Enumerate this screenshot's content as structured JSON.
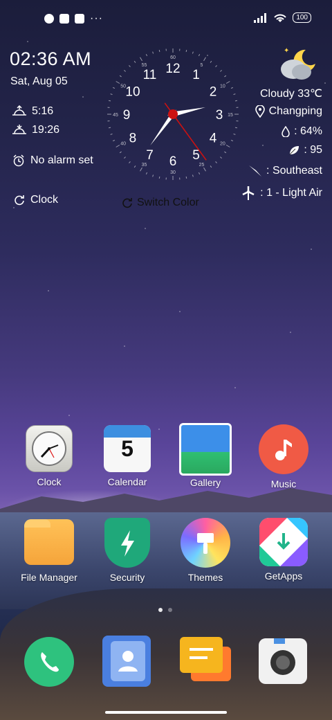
{
  "status_bar": {
    "battery": "100"
  },
  "clock_widget": {
    "time": "02:36 AM",
    "date": "Sat, Aug 05",
    "sunrise": "5:16",
    "sunset": "19:26",
    "alarm": "No alarm set",
    "clock_link": "Clock",
    "switch_color": "Switch Color",
    "dial_hours": [
      "12",
      "1",
      "2",
      "3",
      "4",
      "5",
      "6",
      "7",
      "8",
      "9",
      "10",
      "11"
    ],
    "dial_minutes": [
      "60",
      "5",
      "10",
      "15",
      "20",
      "25",
      "30",
      "35",
      "40",
      "45",
      "50",
      "55"
    ],
    "hands": {
      "hour": 2.6,
      "minute": 36,
      "second": 24
    },
    "accent_color": "#cc1111"
  },
  "weather_widget": {
    "condition": "Cloudy 33℃",
    "location": "Changping",
    "humidity": ": 64%",
    "aqi": ": 95",
    "wind_direction": ": Southeast",
    "wind_level": ": 1 - Light Air"
  },
  "apps": {
    "clock": "Clock",
    "calendar": "Calendar",
    "calendar_day": "5",
    "gallery": "Gallery",
    "music": "Music",
    "file_manager": "File Manager",
    "security": "Security",
    "themes": "Themes",
    "getapps": "GetApps"
  },
  "dock": [
    "phone-icon",
    "contacts-icon",
    "messaging-icon",
    "camera-icon"
  ],
  "colors": {
    "music": "#f05a45",
    "phone": "#2ec27e",
    "security": "#1fa87a",
    "contacts": "#4a7fe0",
    "messages": "#f6b51e"
  }
}
